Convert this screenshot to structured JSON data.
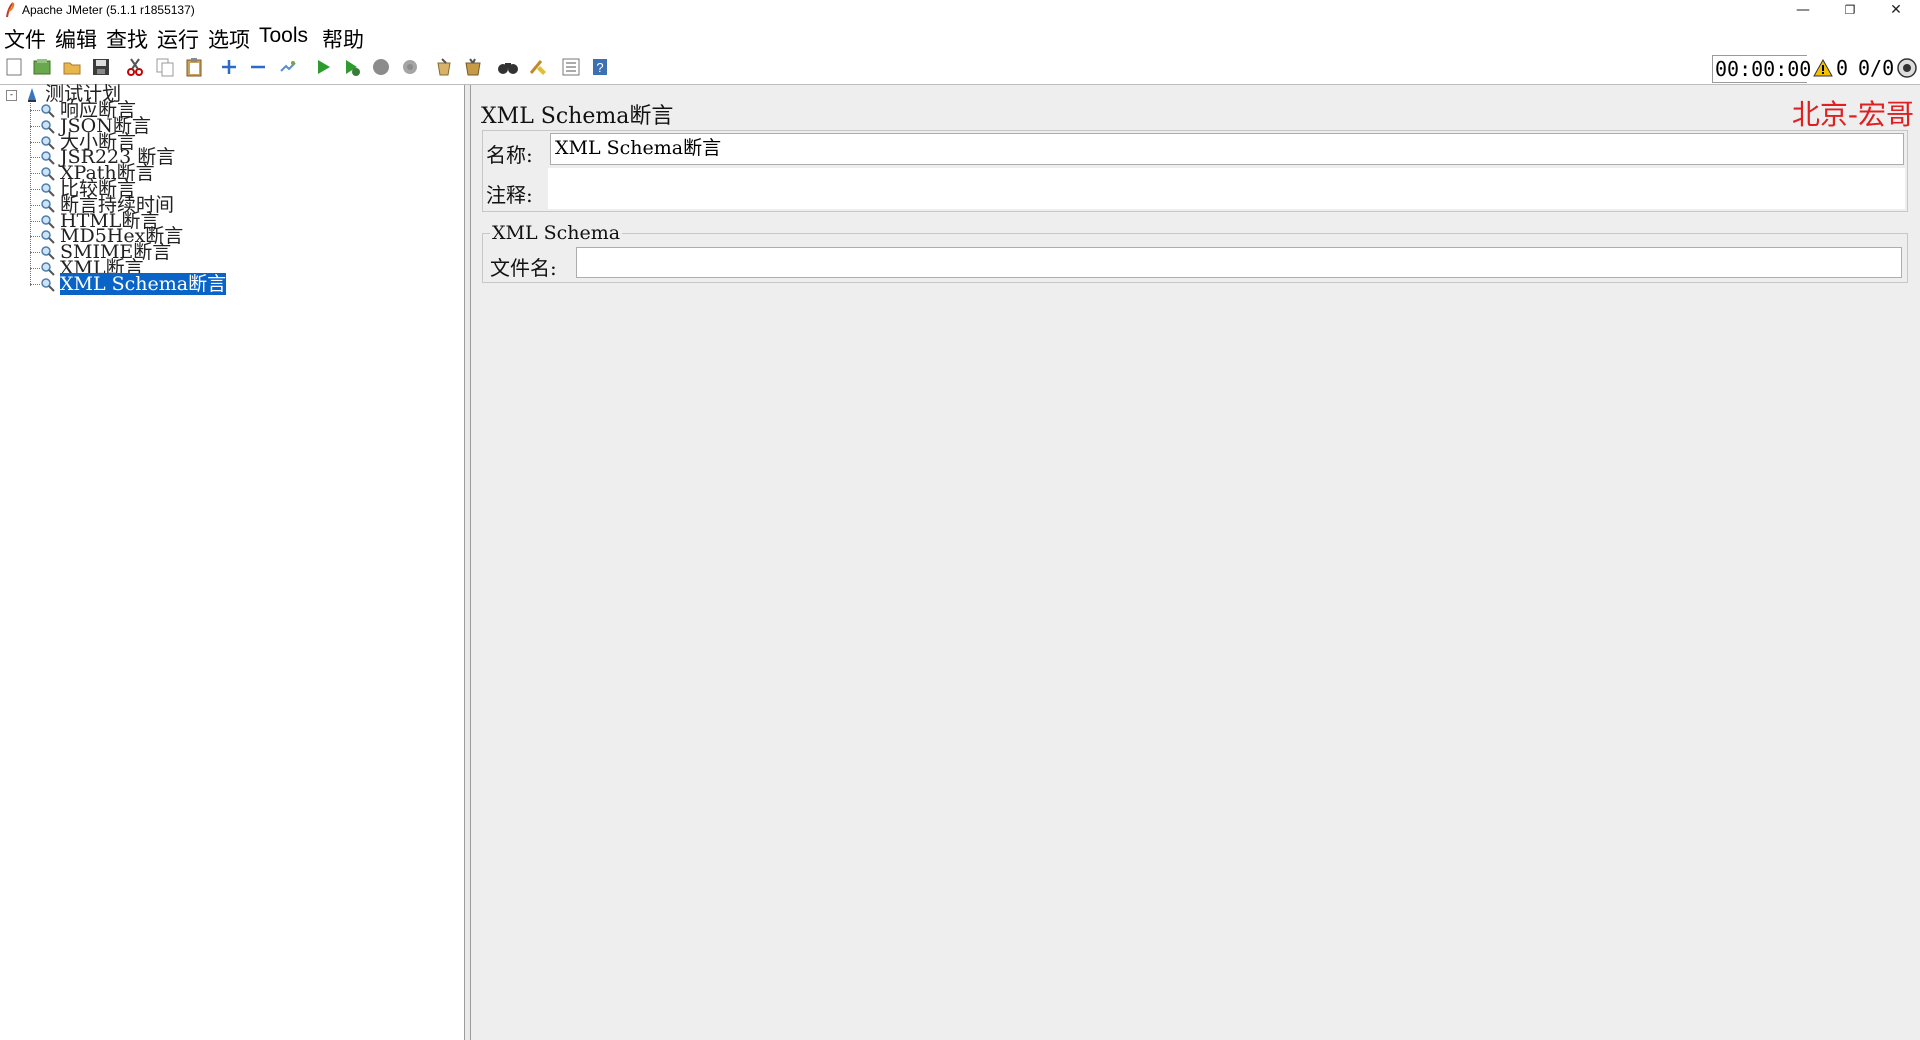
{
  "window": {
    "title": "Apache JMeter (5.1.1 r1855137)",
    "controls": {
      "minimize": "—",
      "restore": "❐",
      "close": "✕"
    }
  },
  "menu": [
    "文件",
    "编辑",
    "查找",
    "运行",
    "选项",
    "Tools",
    "帮助"
  ],
  "toolbar": {
    "icons": [
      "new-icon",
      "templates-icon",
      "open-icon",
      "save-icon",
      "cut-icon",
      "copy-icon",
      "paste-icon",
      "expand-icon",
      "collapse-icon",
      "toggle-icon",
      "start-icon",
      "start-no-pause-icon",
      "stop-icon",
      "shutdown-icon",
      "clear-icon",
      "clear-all-icon",
      "search-icon",
      "reset-search-icon",
      "function-helper-icon",
      "help-icon"
    ],
    "timer": "00:00:00",
    "error_count": "0",
    "threads": "0/0"
  },
  "tree": {
    "root": "测试计划",
    "items": [
      "响应断言",
      "JSON断言",
      "大小断言",
      "JSR223 断言",
      "XPath断言",
      "比较断言",
      "断言持续时间",
      "HTML断言",
      "MD5Hex断言",
      "SMIME断言",
      "XML断言",
      "XML Schema断言"
    ],
    "selected_index": 11
  },
  "panel": {
    "title": "XML Schema断言",
    "brand": "北京-宏哥",
    "name_label": "名称:",
    "name_value": "XML Schema断言",
    "comment_label": "注释:",
    "comment_value": "",
    "schema_legend": "XML Schema",
    "file_label": "文件名:",
    "file_value": ""
  },
  "colors": {
    "selection": "#0a64c8",
    "brand": "#e02020",
    "panel_bg": "#eeeeee"
  }
}
